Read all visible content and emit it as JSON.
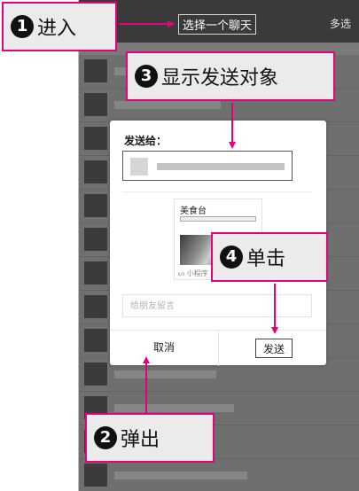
{
  "header": {
    "title": "选择一个聊天",
    "multi_select": "多选"
  },
  "dialog": {
    "title": "发送给：",
    "card": {
      "name": "美食台",
      "footer_label": "小程序"
    },
    "message_placeholder": "给朋友留言",
    "cancel_label": "取消",
    "send_label": "发送"
  },
  "callouts": [
    {
      "num": "1",
      "text": "进入"
    },
    {
      "num": "2",
      "text": "弹出"
    },
    {
      "num": "3",
      "text": "显示发送对象"
    },
    {
      "num": "4",
      "text": "单击"
    }
  ],
  "colors": {
    "callout_border": "#e6007e",
    "arrow": "#e6007e"
  }
}
